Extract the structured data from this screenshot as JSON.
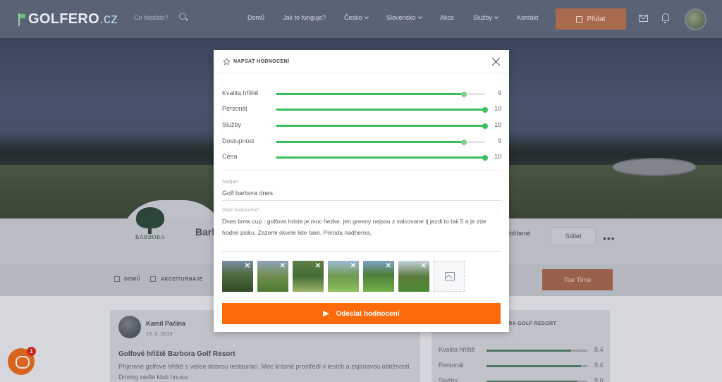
{
  "nav": {
    "logo_main": "GOLFERO",
    "logo_tld": ".cz",
    "search_placeholder": "Co hledáte?",
    "links": [
      {
        "label": "Domů"
      },
      {
        "label": "Jak to funguje?"
      },
      {
        "label": "Česko"
      },
      {
        "label": "Slovensko"
      },
      {
        "label": "Akce"
      },
      {
        "label": "Služby"
      },
      {
        "label": "Kontakt"
      }
    ],
    "add_label": "Přidat"
  },
  "course": {
    "logo_text": "BARBORA",
    "name": "Barb",
    "favorite_label": "Oblíbené",
    "share_label": "Sdílet",
    "more_label": "•••"
  },
  "breadcrumb": {
    "home": "DOMŮ",
    "events": "AKCE/TURNAJE"
  },
  "tee_time_label": "Tee Time",
  "review": {
    "author": "Kamil Pačina",
    "date": "13. 6. 2019",
    "title": "Golfové hřiště Barbora Golf Resort",
    "text": "Příjemné golfové hřiště s velice dobrou restaurací. Moc krásné prostředí v lesích a zajímavou obtížností. Driving vedle klub housu."
  },
  "side_panel": {
    "title": "BORA GOLF RESORT",
    "rows": [
      {
        "label": "Kvalita hřiště",
        "value": "8.4",
        "fraction": 0.84
      },
      {
        "label": "Personál",
        "value": "9.4",
        "fraction": 0.94
      },
      {
        "label": "Služby",
        "value": "9.0",
        "fraction": 0.9
      }
    ]
  },
  "chat": {
    "badge": "1"
  },
  "modal": {
    "title": "NAPSAT HODNOCENÍ",
    "ratings": [
      {
        "label": "Kvalita hřiště",
        "value": 9,
        "max": 10
      },
      {
        "label": "Personál",
        "value": 10,
        "max": 10
      },
      {
        "label": "Služby",
        "value": 10,
        "max": 10
      },
      {
        "label": "Dostupnost",
        "value": 9,
        "max": 10
      },
      {
        "label": "Cena",
        "value": 10,
        "max": 10
      }
    ],
    "title_field": {
      "label": "Nadpis*",
      "value": "Golf barbora dnes"
    },
    "review_field": {
      "label": "Vaše hodnocení*",
      "value": "Dnes bmw cup - golfove hriste je moc hezke, jen greeny nejsou z valcovane tj jezdi to tak 5 a je zde hodne pisku. Zazemi skvele lide take. Priroda nadherna."
    },
    "photos": [
      {
        "remove": "✕"
      },
      {
        "remove": "✕"
      },
      {
        "remove": "✕"
      },
      {
        "remove": "✕"
      },
      {
        "remove": "✕"
      },
      {
        "remove": "✕"
      }
    ],
    "submit_label": "Odeslat hodnocení"
  },
  "colors": {
    "accent": "#fd6a0c",
    "slider": "#3cbf5d",
    "nav_bg": "#5a6275"
  }
}
